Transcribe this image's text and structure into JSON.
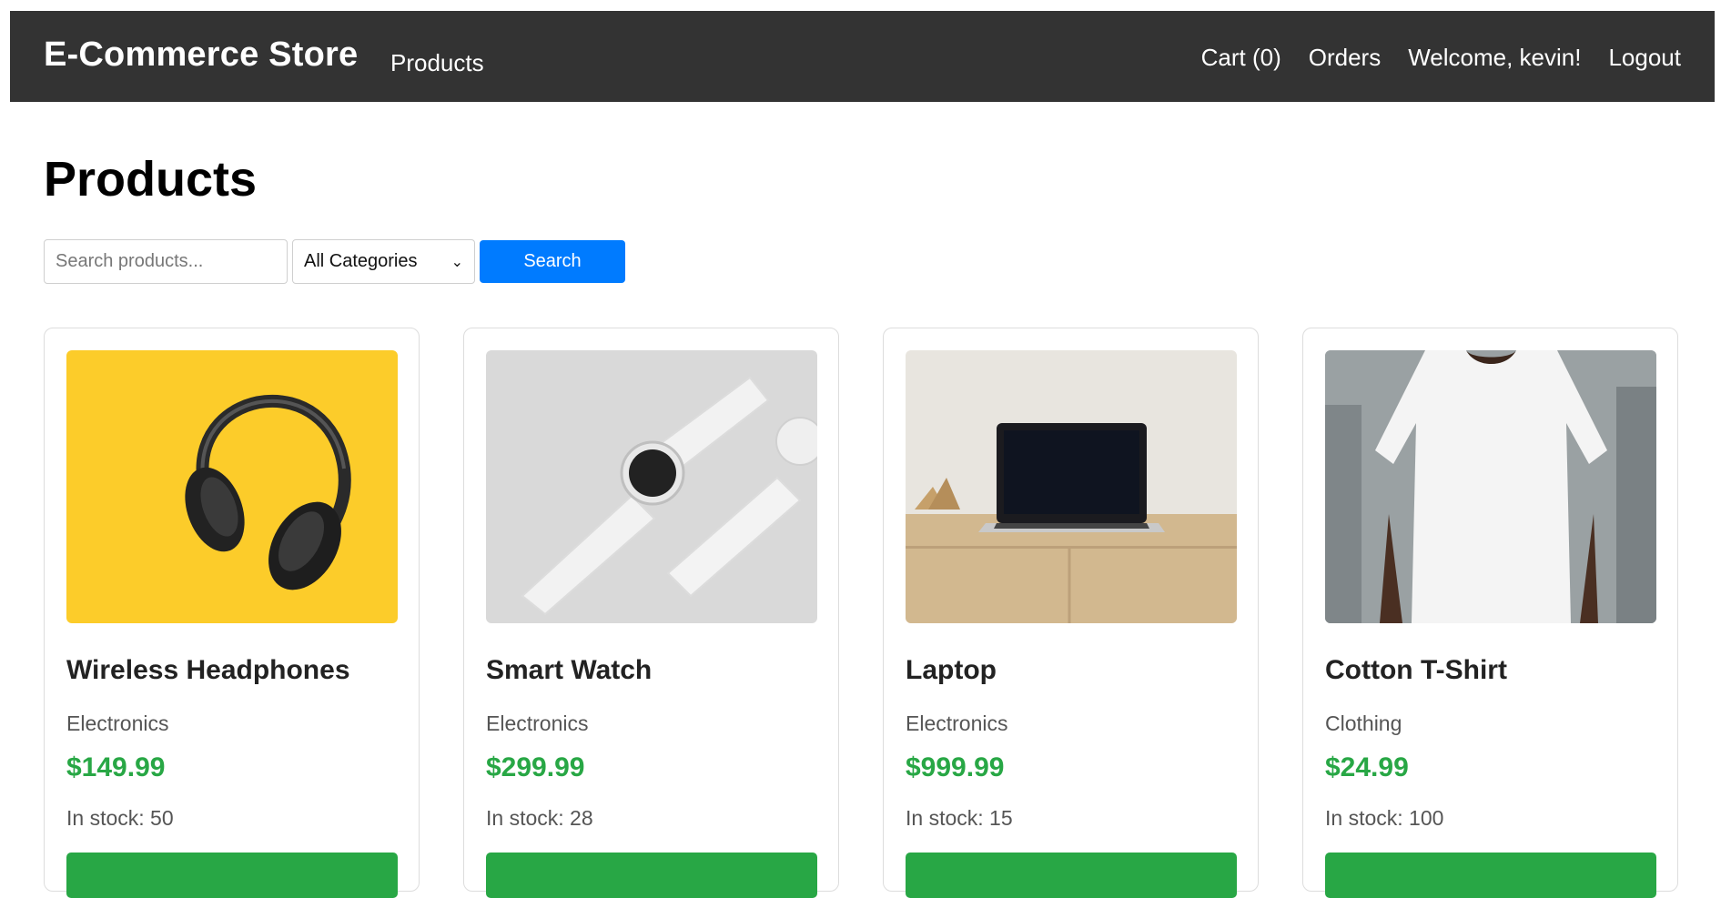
{
  "nav": {
    "brand": "E-Commerce Store",
    "products_link": "Products",
    "cart": "Cart (0)",
    "orders": "Orders",
    "welcome": "Welcome, kevin!",
    "logout": "Logout"
  },
  "page": {
    "title": "Products"
  },
  "search": {
    "placeholder": "Search products...",
    "category_selected": "All Categories",
    "button_label": "Search"
  },
  "products": [
    {
      "name": "Wireless Headphones",
      "category": "Electronics",
      "price": "$149.99",
      "stock": "In stock: 50",
      "image": "headphones"
    },
    {
      "name": "Smart Watch",
      "category": "Electronics",
      "price": "$299.99",
      "stock": "In stock: 28",
      "image": "smartwatch"
    },
    {
      "name": "Laptop",
      "category": "Electronics",
      "price": "$999.99",
      "stock": "In stock: 15",
      "image": "laptop"
    },
    {
      "name": "Cotton T-Shirt",
      "category": "Clothing",
      "price": "$24.99",
      "stock": "In stock: 100",
      "image": "tshirt"
    }
  ],
  "colors": {
    "navbar_bg": "#333333",
    "primary": "#007bff",
    "price_green": "#28a745"
  }
}
